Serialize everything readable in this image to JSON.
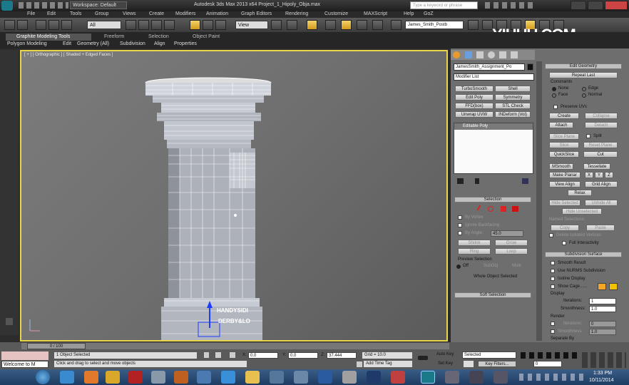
{
  "window": {
    "title": "Autodesk 3ds Max 2013 x64     Project_1_Hipoly_Obja.max",
    "workspace": "Workspace: Default",
    "search_placeholder": "Type a keyword or phrase"
  },
  "watermark": "YIHUU.COM",
  "menu": [
    "File",
    "Edit",
    "Tools",
    "Group",
    "Views",
    "Create",
    "Modifiers",
    "Animation",
    "Graph Editors",
    "Rendering",
    "Customize",
    "MAXScript",
    "Help",
    "GoZ"
  ],
  "toolbar": {
    "selection_filter": "All",
    "view_dropdown": "View",
    "named_selection": "James_Smith_Postb"
  },
  "ribbon": {
    "tabs": [
      "Graphite Modeling Tools",
      "Freeform",
      "Selection",
      "Object Paint"
    ],
    "subtabs": [
      "Polygon Modeling",
      "Edit",
      "Geometry (All)",
      "Subdivision",
      "Align",
      "Properties"
    ]
  },
  "viewport": {
    "label": "[ + ] [ Orthographic ] [ Shaded + Edged Faces ]",
    "object_text_1": "HANDYSIDI",
    "object_text_2": "DERBY&LO"
  },
  "command_panel": {
    "object_name": "JamesSmith_Assignment_Po",
    "modifier_list": "Modifier List",
    "modifier_buttons": [
      "TurboSmooth",
      "Shell",
      "Edit Poly",
      "Symmetry",
      "FFD(box)",
      "STL Check",
      "Unwrap UVW",
      "XForm",
      "Unwrap UVW",
      "INDeform (Vol)"
    ],
    "stack_item": "Editable Poly",
    "selection": {
      "title": "Selection",
      "by_vertex": "By Vertex",
      "ignore_backfacing": "Ignore Backfacing",
      "by_angle": "By Angle:",
      "angle": "45.0",
      "shrink": "Shrink",
      "grow": "Grow",
      "ring": "Ring",
      "loop": "Loop",
      "preview": "Preview Selection",
      "off": "Off",
      "subobj": "SubObj",
      "multi": "Multi",
      "whole_object": "Whole Object Selected"
    },
    "soft_selection": "Soft Selection"
  },
  "edit_geometry": {
    "title": "Edit Geometry",
    "repeat_last": "Repeat Last",
    "constraints": "Constraints",
    "none": "None",
    "edge": "Edge",
    "face": "Face",
    "normal": "Normal",
    "preserve_uvs": "Preserve UVs",
    "create": "Create",
    "collapse": "Collapse",
    "attach": "Attach",
    "detach": "Detach",
    "slice_plane": "Slice Plane",
    "split": "Split",
    "slice": "Slice",
    "reset_plane": "Reset Plane",
    "quickslice": "QuickSlice",
    "cut": "Cut",
    "msmooth": "MSmooth",
    "tessellate": "Tessellate",
    "make_planar": "Make Planar",
    "x": "X",
    "y": "Y",
    "z": "Z",
    "view_align": "View Align",
    "grid_align": "Grid Align",
    "relax": "Relax",
    "hide_selected": "Hide Selected",
    "unhide_all": "Unhide All",
    "hide_unselected": "Hide Unselected",
    "named_selections": "Named Selections:",
    "copy": "Copy",
    "paste": "Paste",
    "delete_isolated": "Delete Isolated Vertices",
    "full_interactivity": "Full Interactivity"
  },
  "subdivision": {
    "title": "Subdivision Surface",
    "smooth_result": "Smooth Result",
    "use_nurms": "Use NURMS Subdivision",
    "isoline": "Isoline Display",
    "show_cage": "Show Cage......",
    "display": "Display",
    "iterations_label": "Iterations:",
    "iterations": "1",
    "smoothness_label": "Smoothness:",
    "smoothness": "1.0",
    "render": "Render",
    "r_iterations": "0",
    "r_smoothness": "1.0",
    "separate_by": "Separate By"
  },
  "status": {
    "timeline": "0 / 100",
    "objects_selected": "1 Object Selected",
    "prompt": "Click and drag to select and move objects",
    "x_label": "X:",
    "x_value": "0.0",
    "y_label": "Y:",
    "y_value": "0.0",
    "z_label": "Z:",
    "z_value": "37.444",
    "grid": "Grid = 10.0",
    "add_time_tag": "Add Time Tag",
    "auto_key": "Auto Key",
    "set_key": "Set Key",
    "selected": "Selected",
    "key_filters": "Key Filters...",
    "frame": "0",
    "maxscript_listener": "Welcome to M"
  },
  "taskbar": {
    "time": "1:33 PM",
    "date": "10/11/2014"
  },
  "colors": {
    "viewport_border": "#e8d54a",
    "cage_orange": "#f5a623",
    "cage_yellow": "#f2c200"
  }
}
